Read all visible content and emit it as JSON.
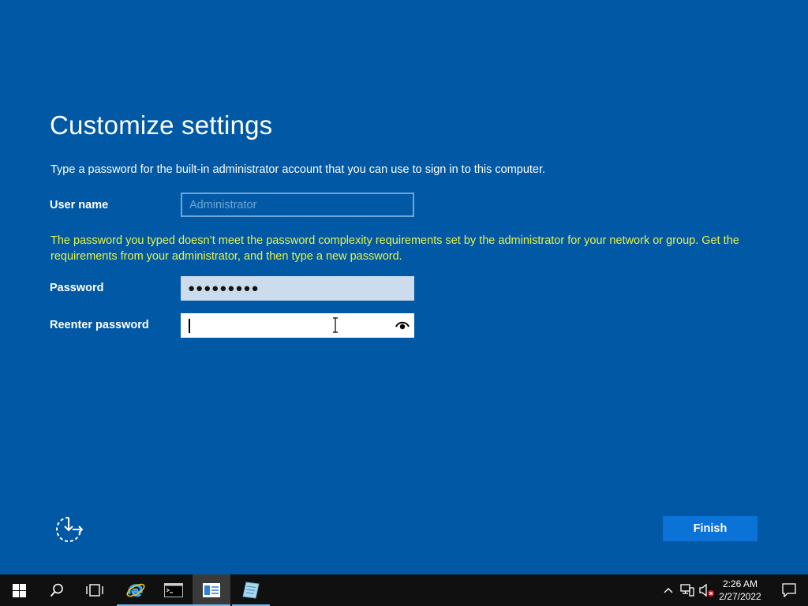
{
  "setup": {
    "title": "Customize settings",
    "instruction": "Type a password for the built-in administrator account that you can use to sign in to this computer.",
    "username_label": "User name",
    "username_placeholder": "Administrator",
    "warning": "The password you typed doesn’t meet the password complexity requirements set by the administrator for your network or group. Get the requirements from your administrator, and then type a new password.",
    "password_label": "Password",
    "password_mask": "●●●●●●●●●",
    "reenter_label": "Reenter password",
    "reenter_value": "",
    "reveal_icon": "eye-icon",
    "accessibility_icon": "ease-of-access-icon",
    "finish_label": "Finish"
  },
  "taskbar": {
    "apps": [
      {
        "name": "start",
        "icon": "windows-logo-icon"
      },
      {
        "name": "search",
        "icon": "search-icon"
      },
      {
        "name": "task-view",
        "icon": "task-view-icon"
      },
      {
        "name": "internet-explorer",
        "icon": "internet-explorer-icon"
      },
      {
        "name": "command-prompt",
        "icon": "command-prompt-icon"
      },
      {
        "name": "server-manager",
        "icon": "server-manager-icon"
      },
      {
        "name": "notepad",
        "icon": "notepad-icon"
      }
    ],
    "tray": {
      "icons": [
        "chevron-up-icon",
        "network-icon",
        "volume-muted-icon"
      ],
      "time": "2:26 AM",
      "date": "2/27/2022"
    }
  },
  "colors": {
    "background": "#0158a5",
    "warning_text": "#e6f54a",
    "finish_button": "#0b72d8",
    "taskbar": "#101010"
  }
}
